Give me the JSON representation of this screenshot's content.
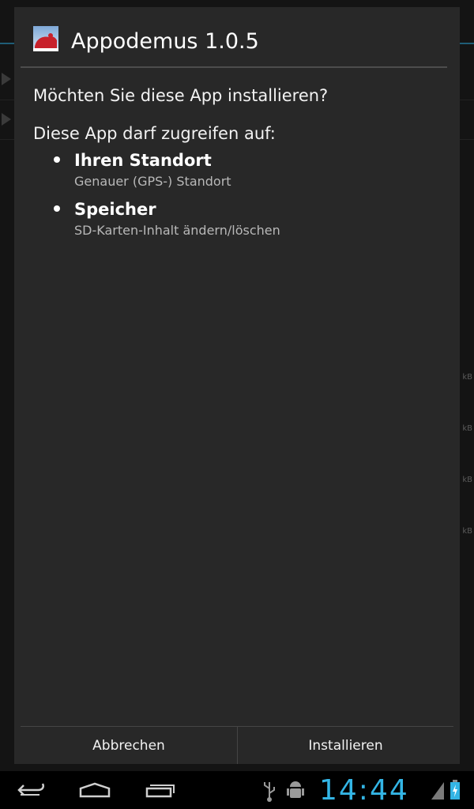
{
  "dialog": {
    "title": "Appodemus 1.0.5",
    "icon": "app-icon",
    "question": "Möchten Sie diese App installieren?",
    "permissions_header": "Diese App darf zugreifen auf:",
    "permissions": [
      {
        "title": "Ihren Standort",
        "detail": "Genauer (GPS-) Standort"
      },
      {
        "title": "Speicher",
        "detail": "SD-Karten-Inhalt ändern/löschen"
      }
    ],
    "buttons": {
      "cancel": "Abbrechen",
      "install": "Installieren"
    }
  },
  "background": {
    "size_labels": [
      "kB",
      "kB",
      "kB",
      "kB"
    ]
  },
  "status": {
    "time": "14:44",
    "icons": [
      "usb-icon",
      "android-debug-icon",
      "signal-icon",
      "battery-charging-icon"
    ]
  },
  "navigation": {
    "icons": [
      "back-icon",
      "home-icon",
      "recent-apps-icon"
    ]
  },
  "colors": {
    "accent": "#33b5e5",
    "dialog_bg": "#282828"
  }
}
